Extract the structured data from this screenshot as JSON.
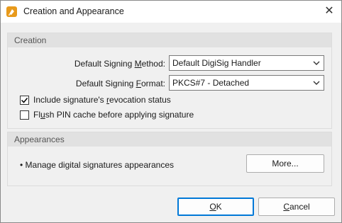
{
  "window": {
    "title": "Creation and Appearance",
    "close_glyph": "✕"
  },
  "creation": {
    "header": "Creation",
    "method_label_pre": "Default Signing ",
    "method_label_key": "M",
    "method_label_post": "ethod:",
    "method_value": "Default DigiSig Handler",
    "format_label_pre": "Default Signing ",
    "format_label_key": "F",
    "format_label_post": "ormat:",
    "format_value": "PKCS#7 - Detached",
    "revocation_pre": "Include signature's ",
    "revocation_key": "r",
    "revocation_post": "evocation status",
    "revocation_checked": true,
    "flush_pre": "Fl",
    "flush_key": "u",
    "flush_post": "sh PIN cache before applying signature",
    "flush_checked": false
  },
  "appearances": {
    "header": "Appearances",
    "manage_text": "• Manage digital signatures appearances",
    "more_button": "More..."
  },
  "buttons": {
    "ok_key": "O",
    "ok_post": "K",
    "cancel_key": "C",
    "cancel_post": "ancel"
  },
  "colors": {
    "app_icon": "#e89a1b",
    "default_button_border": "#0078d7"
  },
  "icons": {
    "app": "app-icon",
    "close": "close-icon",
    "dropdown": "chevron-down-icon",
    "check": "checkmark-icon"
  }
}
